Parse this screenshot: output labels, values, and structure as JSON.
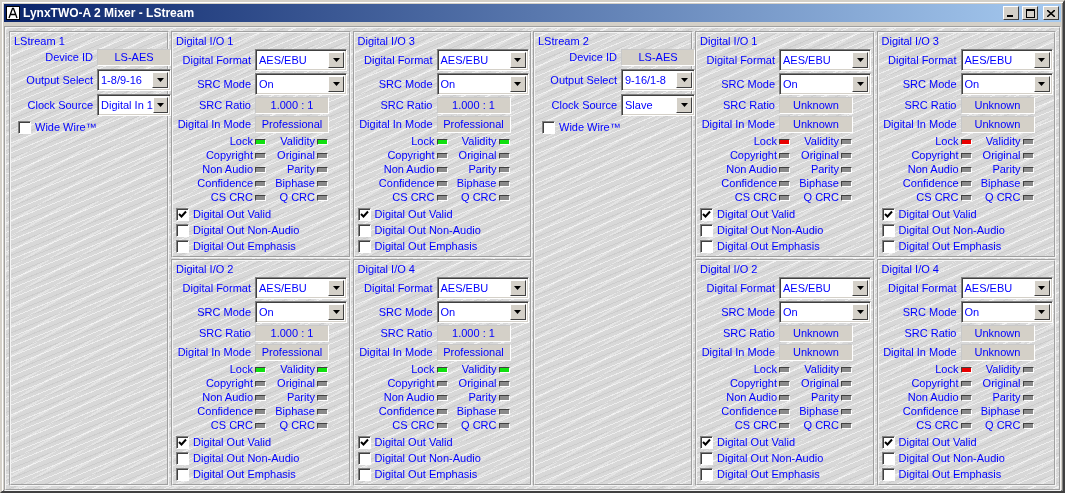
{
  "window": {
    "title": "LynxTWO-A 2 Mixer - LStream"
  },
  "streams": [
    {
      "title": "LStream 1",
      "settings": [
        {
          "label": "Device ID",
          "value": "LS-AES",
          "kind": "readout"
        },
        {
          "label": "Output Select",
          "value": "1-8/9-16",
          "kind": "dropdown"
        },
        {
          "label": "Clock Source",
          "value": "Digital In 1",
          "kind": "dropdown"
        }
      ],
      "wide_wire": {
        "label": "Wide Wire™",
        "checked": false
      },
      "digital_io": [
        {
          "title": "Digital I/O 1",
          "fields": [
            {
              "label": "Digital Format",
              "value": "AES/EBU",
              "kind": "dropdown"
            },
            {
              "label": "SRC Mode",
              "value": "On",
              "kind": "dropdown"
            },
            {
              "label": "SRC Ratio",
              "value": "1.000 : 1",
              "kind": "readout"
            },
            {
              "label": "Digital In Mode",
              "value": "Professional",
              "kind": "readout"
            }
          ],
          "leds": [
            {
              "label": "Lock",
              "lit": true,
              "color": "#10e010"
            },
            {
              "label": "Validity",
              "lit": true,
              "color": "#10e010"
            },
            {
              "label": "Copyright",
              "lit": false
            },
            {
              "label": "Original",
              "lit": false
            },
            {
              "label": "Non Audio",
              "lit": false
            },
            {
              "label": "Parity",
              "lit": false
            },
            {
              "label": "Confidence",
              "lit": false
            },
            {
              "label": "Biphase",
              "lit": false
            },
            {
              "label": "CS CRC",
              "lit": false
            },
            {
              "label": "Q CRC",
              "lit": false
            }
          ],
          "options": [
            {
              "label": "Digital Out Valid",
              "checked": true
            },
            {
              "label": "Digital Out Non-Audio",
              "checked": false
            },
            {
              "label": "Digital Out Emphasis",
              "checked": false
            }
          ]
        },
        {
          "title": "Digital I/O 3",
          "fields": [
            {
              "label": "Digital Format",
              "value": "AES/EBU",
              "kind": "dropdown"
            },
            {
              "label": "SRC Mode",
              "value": "On",
              "kind": "dropdown"
            },
            {
              "label": "SRC Ratio",
              "value": "1.000 : 1",
              "kind": "readout"
            },
            {
              "label": "Digital In Mode",
              "value": "Professional",
              "kind": "readout"
            }
          ],
          "leds": [
            {
              "label": "Lock",
              "lit": true,
              "color": "#10e010"
            },
            {
              "label": "Validity",
              "lit": true,
              "color": "#10e010"
            },
            {
              "label": "Copyright",
              "lit": false
            },
            {
              "label": "Original",
              "lit": false
            },
            {
              "label": "Non Audio",
              "lit": false
            },
            {
              "label": "Parity",
              "lit": false
            },
            {
              "label": "Confidence",
              "lit": false
            },
            {
              "label": "Biphase",
              "lit": false
            },
            {
              "label": "CS CRC",
              "lit": false
            },
            {
              "label": "Q CRC",
              "lit": false
            }
          ],
          "options": [
            {
              "label": "Digital Out Valid",
              "checked": true
            },
            {
              "label": "Digital Out Non-Audio",
              "checked": false
            },
            {
              "label": "Digital Out Emphasis",
              "checked": false
            }
          ]
        },
        {
          "title": "Digital I/O 2",
          "fields": [
            {
              "label": "Digital Format",
              "value": "AES/EBU",
              "kind": "dropdown"
            },
            {
              "label": "SRC Mode",
              "value": "On",
              "kind": "dropdown"
            },
            {
              "label": "SRC Ratio",
              "value": "1.000 : 1",
              "kind": "readout"
            },
            {
              "label": "Digital In Mode",
              "value": "Professional",
              "kind": "readout"
            }
          ],
          "leds": [
            {
              "label": "Lock",
              "lit": true,
              "color": "#10e010"
            },
            {
              "label": "Validity",
              "lit": true,
              "color": "#10e010"
            },
            {
              "label": "Copyright",
              "lit": false
            },
            {
              "label": "Original",
              "lit": false
            },
            {
              "label": "Non Audio",
              "lit": false
            },
            {
              "label": "Parity",
              "lit": false
            },
            {
              "label": "Confidence",
              "lit": false
            },
            {
              "label": "Biphase",
              "lit": false
            },
            {
              "label": "CS CRC",
              "lit": false
            },
            {
              "label": "Q CRC",
              "lit": false
            }
          ],
          "options": [
            {
              "label": "Digital Out Valid",
              "checked": true
            },
            {
              "label": "Digital Out Non-Audio",
              "checked": false
            },
            {
              "label": "Digital Out Emphasis",
              "checked": false
            }
          ]
        },
        {
          "title": "Digital I/O 4",
          "fields": [
            {
              "label": "Digital Format",
              "value": "AES/EBU",
              "kind": "dropdown"
            },
            {
              "label": "SRC Mode",
              "value": "On",
              "kind": "dropdown"
            },
            {
              "label": "SRC Ratio",
              "value": "1.000 : 1",
              "kind": "readout"
            },
            {
              "label": "Digital In Mode",
              "value": "Professional",
              "kind": "readout"
            }
          ],
          "leds": [
            {
              "label": "Lock",
              "lit": true,
              "color": "#10e010"
            },
            {
              "label": "Validity",
              "lit": true,
              "color": "#10e010"
            },
            {
              "label": "Copyright",
              "lit": false
            },
            {
              "label": "Original",
              "lit": false
            },
            {
              "label": "Non Audio",
              "lit": false
            },
            {
              "label": "Parity",
              "lit": false
            },
            {
              "label": "Confidence",
              "lit": false
            },
            {
              "label": "Biphase",
              "lit": false
            },
            {
              "label": "CS CRC",
              "lit": false
            },
            {
              "label": "Q CRC",
              "lit": false
            }
          ],
          "options": [
            {
              "label": "Digital Out Valid",
              "checked": true
            },
            {
              "label": "Digital Out Non-Audio",
              "checked": false
            },
            {
              "label": "Digital Out Emphasis",
              "checked": false
            }
          ]
        }
      ]
    },
    {
      "title": "LStream 2",
      "settings": [
        {
          "label": "Device ID",
          "value": "LS-AES",
          "kind": "readout"
        },
        {
          "label": "Output Select",
          "value": "9-16/1-8",
          "kind": "dropdown"
        },
        {
          "label": "Clock Source",
          "value": "Slave",
          "kind": "dropdown"
        }
      ],
      "wide_wire": {
        "label": "Wide Wire™",
        "checked": false
      },
      "digital_io": [
        {
          "title": "Digital I/O 1",
          "fields": [
            {
              "label": "Digital Format",
              "value": "AES/EBU",
              "kind": "dropdown"
            },
            {
              "label": "SRC Mode",
              "value": "On",
              "kind": "dropdown"
            },
            {
              "label": "SRC Ratio",
              "value": "Unknown",
              "kind": "readout"
            },
            {
              "label": "Digital In Mode",
              "value": "Unknown",
              "kind": "readout"
            }
          ],
          "leds": [
            {
              "label": "Lock",
              "lit": true,
              "color": "#e80000"
            },
            {
              "label": "Validity",
              "lit": false
            },
            {
              "label": "Copyright",
              "lit": false
            },
            {
              "label": "Original",
              "lit": false
            },
            {
              "label": "Non Audio",
              "lit": false
            },
            {
              "label": "Parity",
              "lit": false
            },
            {
              "label": "Confidence",
              "lit": false
            },
            {
              "label": "Biphase",
              "lit": false
            },
            {
              "label": "CS CRC",
              "lit": false
            },
            {
              "label": "Q CRC",
              "lit": false
            }
          ],
          "options": [
            {
              "label": "Digital Out Valid",
              "checked": true
            },
            {
              "label": "Digital Out Non-Audio",
              "checked": false
            },
            {
              "label": "Digital Out Emphasis",
              "checked": false
            }
          ]
        },
        {
          "title": "Digital I/O 3",
          "fields": [
            {
              "label": "Digital Format",
              "value": "AES/EBU",
              "kind": "dropdown"
            },
            {
              "label": "SRC Mode",
              "value": "On",
              "kind": "dropdown"
            },
            {
              "label": "SRC Ratio",
              "value": "Unknown",
              "kind": "readout"
            },
            {
              "label": "Digital In Mode",
              "value": "Unknown",
              "kind": "readout"
            }
          ],
          "leds": [
            {
              "label": "Lock",
              "lit": true,
              "color": "#e80000"
            },
            {
              "label": "Validity",
              "lit": false
            },
            {
              "label": "Copyright",
              "lit": false
            },
            {
              "label": "Original",
              "lit": false
            },
            {
              "label": "Non Audio",
              "lit": false
            },
            {
              "label": "Parity",
              "lit": false
            },
            {
              "label": "Confidence",
              "lit": false
            },
            {
              "label": "Biphase",
              "lit": false
            },
            {
              "label": "CS CRC",
              "lit": false
            },
            {
              "label": "Q CRC",
              "lit": false
            }
          ],
          "options": [
            {
              "label": "Digital Out Valid",
              "checked": true
            },
            {
              "label": "Digital Out Non-Audio",
              "checked": false
            },
            {
              "label": "Digital Out Emphasis",
              "checked": false
            }
          ]
        },
        {
          "title": "Digital I/O 2",
          "fields": [
            {
              "label": "Digital Format",
              "value": "AES/EBU",
              "kind": "dropdown"
            },
            {
              "label": "SRC Mode",
              "value": "On",
              "kind": "dropdown"
            },
            {
              "label": "SRC Ratio",
              "value": "Unknown",
              "kind": "readout"
            },
            {
              "label": "Digital In Mode",
              "value": "Unknown",
              "kind": "readout"
            }
          ],
          "leds": [
            {
              "label": "Lock",
              "lit": false
            },
            {
              "label": "Validity",
              "lit": false
            },
            {
              "label": "Copyright",
              "lit": false
            },
            {
              "label": "Original",
              "lit": false
            },
            {
              "label": "Non Audio",
              "lit": false
            },
            {
              "label": "Parity",
              "lit": false
            },
            {
              "label": "Confidence",
              "lit": false
            },
            {
              "label": "Biphase",
              "lit": false
            },
            {
              "label": "CS CRC",
              "lit": false
            },
            {
              "label": "Q CRC",
              "lit": false
            }
          ],
          "options": [
            {
              "label": "Digital Out Valid",
              "checked": true
            },
            {
              "label": "Digital Out Non-Audio",
              "checked": false
            },
            {
              "label": "Digital Out Emphasis",
              "checked": false
            }
          ]
        },
        {
          "title": "Digital I/O 4",
          "fields": [
            {
              "label": "Digital Format",
              "value": "AES/EBU",
              "kind": "dropdown"
            },
            {
              "label": "SRC Mode",
              "value": "On",
              "kind": "dropdown"
            },
            {
              "label": "SRC Ratio",
              "value": "Unknown",
              "kind": "readout"
            },
            {
              "label": "Digital In Mode",
              "value": "Unknown",
              "kind": "readout"
            }
          ],
          "leds": [
            {
              "label": "Lock",
              "lit": true,
              "color": "#e80000"
            },
            {
              "label": "Validity",
              "lit": false
            },
            {
              "label": "Copyright",
              "lit": false
            },
            {
              "label": "Original",
              "lit": false
            },
            {
              "label": "Non Audio",
              "lit": false
            },
            {
              "label": "Parity",
              "lit": false
            },
            {
              "label": "Confidence",
              "lit": false
            },
            {
              "label": "Biphase",
              "lit": false
            },
            {
              "label": "CS CRC",
              "lit": false
            },
            {
              "label": "Q CRC",
              "lit": false
            }
          ],
          "options": [
            {
              "label": "Digital Out Valid",
              "checked": true
            },
            {
              "label": "Digital Out Non-Audio",
              "checked": false
            },
            {
              "label": "Digital Out Emphasis",
              "checked": false
            }
          ]
        }
      ]
    }
  ]
}
